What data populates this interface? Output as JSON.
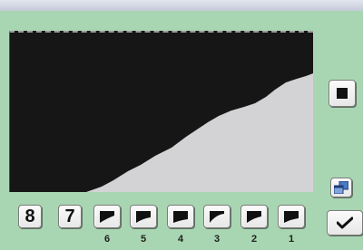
{
  "number_buttons": [
    "8",
    "7"
  ],
  "curve_presets": [
    {
      "label": "6",
      "icon": "curve-preset-icon"
    },
    {
      "label": "5",
      "icon": "curve-preset-icon"
    },
    {
      "label": "4",
      "icon": "curve-preset-icon"
    },
    {
      "label": "3",
      "icon": "curve-preset-icon"
    },
    {
      "label": "2",
      "icon": "curve-preset-icon"
    },
    {
      "label": "1",
      "icon": "curve-preset-icon"
    }
  ],
  "right_panel": {
    "stop_icon": "stop-square-icon",
    "misc_icon": "window-swap-icon",
    "ok_icon": "checkmark-icon"
  },
  "colors": {
    "panel_bg": "#a9d6b2",
    "display_bg": "#161616",
    "curve_fill": "#d3d3d5"
  }
}
